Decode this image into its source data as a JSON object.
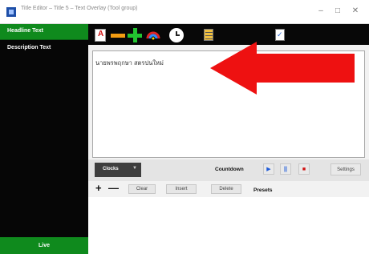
{
  "window": {
    "title": "Title Editor – Title 5 – Text Overlay (Tool group)",
    "minimize_icon": "minimize-icon",
    "maximize_icon": "maximize-icon",
    "close_icon": "close-icon"
  },
  "sidebar": {
    "items": [
      {
        "label": "Headline Text",
        "selected": true
      },
      {
        "label": "Description Text",
        "selected": false
      }
    ],
    "footer_label": "Live"
  },
  "toolbar": {
    "data_source_label": "Data Source",
    "spelling_label": "Spelling",
    "icons": [
      "text-color-icon",
      "remove-icon",
      "add-icon",
      "color-wheel-icon",
      "clock-icon",
      "data-source-icon",
      "spelling-icon"
    ]
  },
  "editor": {
    "text": "นายพรพฤกษา สตรปนใหม่"
  },
  "clocks": {
    "dropdown_label": "Clocks",
    "countdown_label": "Countdown",
    "settings_label": "Settings"
  },
  "presets": {
    "clear_label": "Clear",
    "insert_label": "Insert",
    "delete_label": "Delete",
    "presets_label": "Presets"
  },
  "colors": {
    "accent_green": "#0f8a1d",
    "arrow_red": "#ee1111"
  }
}
